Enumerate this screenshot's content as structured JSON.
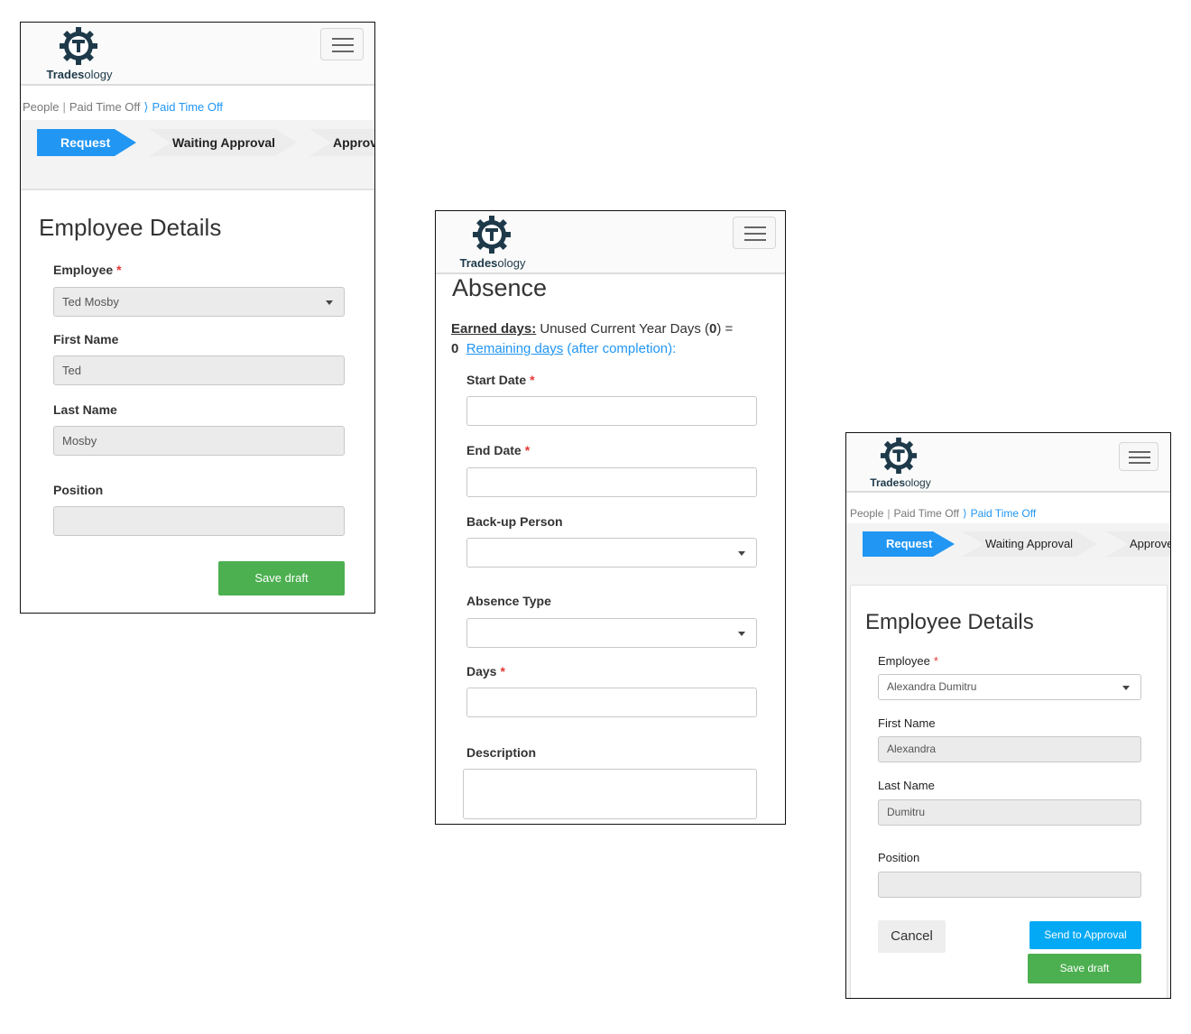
{
  "brand": {
    "logo_bold": "Trades",
    "logo_light": "ology"
  },
  "breadcrumb": {
    "item1": "People",
    "sep": "|",
    "item2": "Paid Time Off",
    "chev": "⟩",
    "current": "Paid Time Off"
  },
  "steps": {
    "request": "Request",
    "waiting": "Waiting Approval",
    "approved": "Approv"
  },
  "screen1": {
    "title": "Employee Details",
    "employee_label": "Employee",
    "employee_value": "Ted Mosby",
    "first_label": "First Name",
    "first_value": "Ted",
    "last_label": "Last Name",
    "last_value": "Mosby",
    "position_label": "Position",
    "position_value": "",
    "save_label": "Save draft"
  },
  "screen2": {
    "title": "Absence",
    "earned_label": "Earned days:",
    "earned_text": " Unused Current Year Days (",
    "earned_zero": "0",
    "earned_eq": ") =",
    "total": "0",
    "remaining_label": "Remaining days",
    "remaining_suffix": " (after completion):",
    "start_label": "Start Date",
    "end_label": "End Date",
    "backup_label": "Back-up Person",
    "type_label": "Absence Type",
    "days_label": "Days",
    "desc_label": "Description"
  },
  "screen3": {
    "title": "Employee Details",
    "employee_label": "Employee",
    "employee_value": "Alexandra Dumitru",
    "first_label": "First Name",
    "first_value": "Alexandra",
    "last_label": "Last Name",
    "last_value": "Dumitru",
    "position_label": "Position",
    "position_value": "",
    "cancel_label": "Cancel",
    "send_label": "Send to Approval",
    "save_label": "Save draft",
    "approved_step": "Approve"
  },
  "required_mark": "*",
  "colors": {
    "accent": "#2196f3",
    "save": "#4caf50",
    "send": "#03a9f4",
    "required": "#e53935",
    "brand": "#1e3a4a"
  }
}
